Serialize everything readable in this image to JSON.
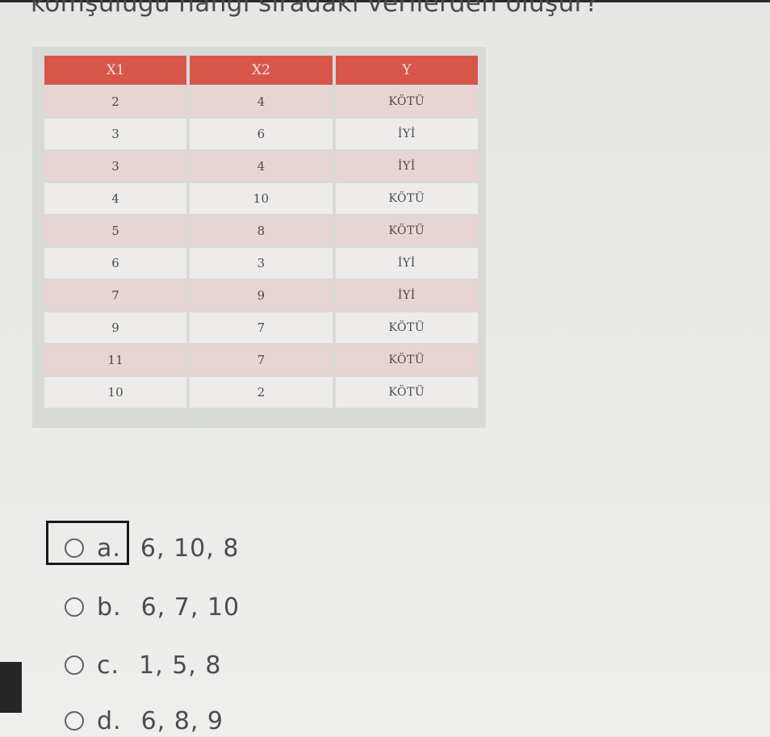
{
  "question": {
    "text": "komşuluğu hangi sıradaki verilerden oluşur?"
  },
  "table": {
    "headers": [
      "X1",
      "X2",
      "Y"
    ],
    "rows": [
      [
        "2",
        "4",
        "KÖTÜ"
      ],
      [
        "3",
        "6",
        "İYİ"
      ],
      [
        "3",
        "4",
        "İYİ"
      ],
      [
        "4",
        "10",
        "KÖTÜ"
      ],
      [
        "5",
        "8",
        "KÖTÜ"
      ],
      [
        "6",
        "3",
        "İYİ"
      ],
      [
        "7",
        "9",
        "İYİ"
      ],
      [
        "9",
        "7",
        "KÖTÜ"
      ],
      [
        "11",
        "7",
        "KÖTÜ"
      ],
      [
        "10",
        "2",
        "KÖTÜ"
      ]
    ]
  },
  "options": [
    {
      "letter": "a.",
      "value": "6, 10, 8",
      "selected": false,
      "focused": true
    },
    {
      "letter": "b.",
      "value": "6, 7, 10",
      "selected": false,
      "focused": false
    },
    {
      "letter": "c.",
      "value": "1, 5, 8",
      "selected": false,
      "focused": false
    },
    {
      "letter": "d.",
      "value": "6, 8, 9",
      "selected": false,
      "focused": false
    }
  ],
  "colors": {
    "header_bg": "#d8554a",
    "row_odd": "#e8d4d3",
    "row_even": "#eeeceb",
    "focus_border": "#1a1a1a"
  }
}
